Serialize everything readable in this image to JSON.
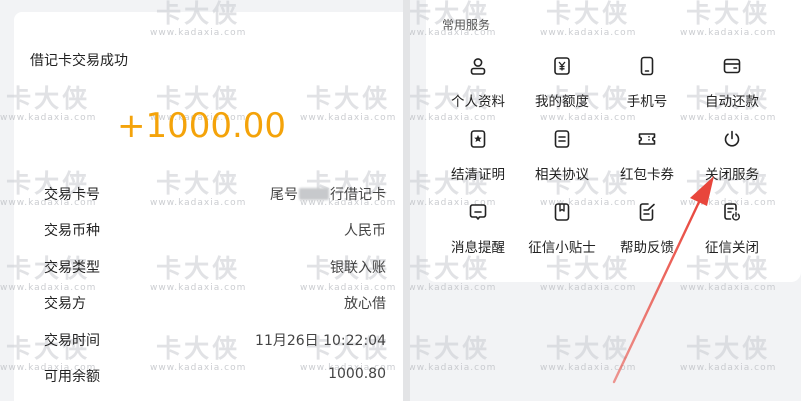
{
  "watermark": {
    "brand": "卡大侠",
    "url": "www.kadaxia.com"
  },
  "transaction": {
    "title": "借记卡交易成功",
    "amount": "+1000.00",
    "rows": [
      {
        "label": "交易卡号",
        "value_prefix": "尾号",
        "value_suffix": "行借记卡"
      },
      {
        "label": "交易币种",
        "value": "人民币"
      },
      {
        "label": "交易类型",
        "value": "银联入账"
      },
      {
        "label": "交易方",
        "value": "放心借"
      },
      {
        "label": "交易时间",
        "value": "11月26日 10:22:04"
      },
      {
        "label": "可用余额",
        "value": "1000.80"
      }
    ]
  },
  "services": {
    "title": "常用服务",
    "items": [
      {
        "label": "个人资料",
        "icon": "person-icon"
      },
      {
        "label": "我的额度",
        "icon": "yuan-icon"
      },
      {
        "label": "手机号",
        "icon": "phone-icon"
      },
      {
        "label": "自动还款",
        "icon": "wallet-icon"
      },
      {
        "label": "结清证明",
        "icon": "certificate-icon"
      },
      {
        "label": "相关协议",
        "icon": "document-icon"
      },
      {
        "label": "红包卡券",
        "icon": "ticket-icon"
      },
      {
        "label": "关闭服务",
        "icon": "power-icon"
      },
      {
        "label": "消息提醒",
        "icon": "message-icon"
      },
      {
        "label": "征信小贴士",
        "icon": "bookmark-icon"
      },
      {
        "label": "帮助反馈",
        "icon": "edit-icon"
      },
      {
        "label": "征信关闭",
        "icon": "credit-power-icon"
      }
    ]
  },
  "colors": {
    "amount": "#f4a30a",
    "arrow": "#e8463c"
  }
}
